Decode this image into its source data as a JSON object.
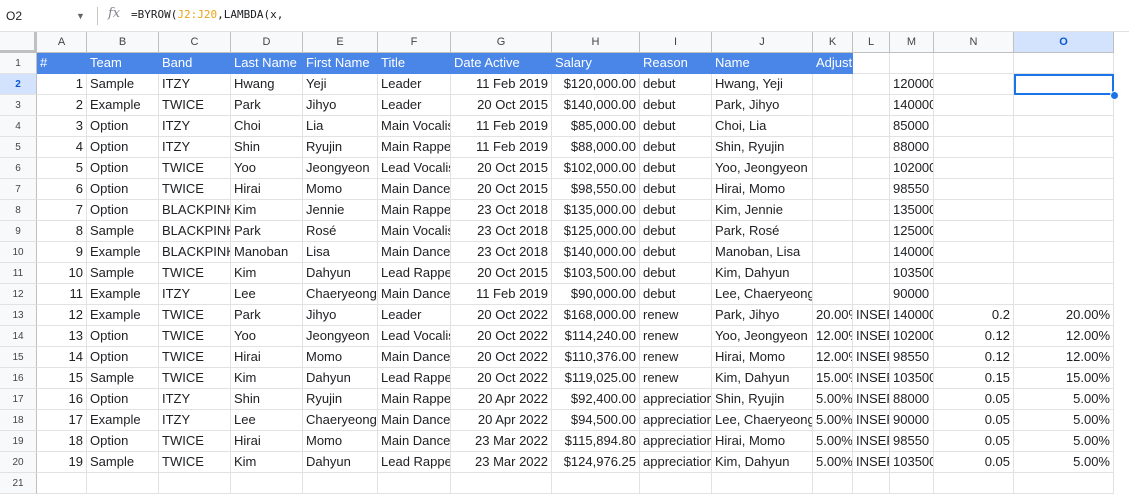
{
  "formula_bar": {
    "name_box": "O2",
    "fx_label": "fx",
    "formula_prefix": "=BYROW(",
    "formula_range": "J2:J20",
    "formula_suffix": ",LAMBDA(x,"
  },
  "columns": [
    "A",
    "B",
    "C",
    "D",
    "E",
    "F",
    "G",
    "H",
    "I",
    "J",
    "K",
    "L",
    "M",
    "N",
    "O"
  ],
  "selected_column": "O",
  "selected_row": "2",
  "rows": [
    "1",
    "2",
    "3",
    "4",
    "5",
    "6",
    "7",
    "8",
    "9",
    "10",
    "11",
    "12",
    "13",
    "14",
    "15",
    "16",
    "17",
    "18",
    "19",
    "20",
    "21"
  ],
  "header_row": [
    "#",
    "Team",
    "Band",
    "Last Name",
    "First Name",
    "Title",
    "Date Active",
    "Salary",
    "Reason",
    "Name",
    "Adjustment"
  ],
  "data_rows": [
    [
      "1",
      "Sample",
      "ITZY",
      "Hwang",
      "Yeji",
      "Leader",
      "11 Feb 2019",
      "$120,000.00",
      "debut",
      "Hwang, Yeji",
      "",
      "",
      "120000",
      "",
      ""
    ],
    [
      "2",
      "Example",
      "TWICE",
      "Park",
      "Jihyo",
      "Leader",
      "20 Oct 2015",
      "$140,000.00",
      "debut",
      "Park, Jihyo",
      "",
      "",
      "140000",
      "",
      ""
    ],
    [
      "3",
      "Option",
      "ITZY",
      "Choi",
      "Lia",
      "Main Vocalist",
      "11 Feb 2019",
      "$85,000.00",
      "debut",
      "Choi, Lia",
      "",
      "",
      "85000",
      "",
      ""
    ],
    [
      "4",
      "Option",
      "ITZY",
      "Shin",
      "Ryujin",
      "Main Rapper",
      "11 Feb 2019",
      "$88,000.00",
      "debut",
      "Shin, Ryujin",
      "",
      "",
      "88000",
      "",
      ""
    ],
    [
      "5",
      "Option",
      "TWICE",
      "Yoo",
      "Jeongyeon",
      "Lead Vocalist",
      "20 Oct 2015",
      "$102,000.00",
      "debut",
      "Yoo, Jeongyeon",
      "",
      "",
      "102000",
      "",
      ""
    ],
    [
      "6",
      "Option",
      "TWICE",
      "Hirai",
      "Momo",
      "Main Dancer",
      "20 Oct 2015",
      "$98,550.00",
      "debut",
      "Hirai, Momo",
      "",
      "",
      "98550",
      "",
      ""
    ],
    [
      "7",
      "Option",
      "BLACKPINK",
      "Kim",
      "Jennie",
      "Main Rapper",
      "23 Oct 2018",
      "$135,000.00",
      "debut",
      "Kim, Jennie",
      "",
      "",
      "135000",
      "",
      ""
    ],
    [
      "8",
      "Sample",
      "BLACKPINK",
      "Park",
      "Rosé",
      "Main Vocalist",
      "23 Oct 2018",
      "$125,000.00",
      "debut",
      "Park, Rosé",
      "",
      "",
      "125000",
      "",
      ""
    ],
    [
      "9",
      "Example",
      "BLACKPINK",
      "Manoban",
      "Lisa",
      "Main Dancer",
      "23 Oct 2018",
      "$140,000.00",
      "debut",
      "Manoban, Lisa",
      "",
      "",
      "140000",
      "",
      ""
    ],
    [
      "10",
      "Sample",
      "TWICE",
      "Kim",
      "Dahyun",
      "Lead Rapper",
      "20 Oct 2015",
      "$103,500.00",
      "debut",
      "Kim, Dahyun",
      "",
      "",
      "103500",
      "",
      ""
    ],
    [
      "11",
      "Example",
      "ITZY",
      "Lee",
      "Chaeryeong",
      "Main Dancer",
      "11 Feb 2019",
      "$90,000.00",
      "debut",
      "Lee, Chaeryeong",
      "",
      "",
      "90000",
      "",
      ""
    ],
    [
      "12",
      "Example",
      "TWICE",
      "Park",
      "Jihyo",
      "Leader",
      "20 Oct 2022",
      "$168,000.00",
      "renew",
      "Park, Jihyo",
      "20.00%",
      "INSERT",
      "140000",
      "0.2",
      "20.00%"
    ],
    [
      "13",
      "Option",
      "TWICE",
      "Yoo",
      "Jeongyeon",
      "Lead Vocalist",
      "20 Oct 2022",
      "$114,240.00",
      "renew",
      "Yoo, Jeongyeon",
      "12.00%",
      "INSERT",
      "102000",
      "0.12",
      "12.00%"
    ],
    [
      "14",
      "Option",
      "TWICE",
      "Hirai",
      "Momo",
      "Main Dancer",
      "20 Oct 2022",
      "$110,376.00",
      "renew",
      "Hirai, Momo",
      "12.00%",
      "INSERT",
      "98550",
      "0.12",
      "12.00%"
    ],
    [
      "15",
      "Sample",
      "TWICE",
      "Kim",
      "Dahyun",
      "Lead Rapper",
      "20 Oct 2022",
      "$119,025.00",
      "renew",
      "Kim, Dahyun",
      "15.00%",
      "INSERT",
      "103500",
      "0.15",
      "15.00%"
    ],
    [
      "16",
      "Option",
      "ITZY",
      "Shin",
      "Ryujin",
      "Main Rapper",
      "20 Apr 2022",
      "$92,400.00",
      "appreciation",
      "Shin, Ryujin",
      "5.00%",
      "INSERT",
      "88000",
      "0.05",
      "5.00%"
    ],
    [
      "17",
      "Example",
      "ITZY",
      "Lee",
      "Chaeryeong",
      "Main Dancer",
      "20 Apr 2022",
      "$94,500.00",
      "appreciation",
      "Lee, Chaeryeong",
      "5.00%",
      "INSERT",
      "90000",
      "0.05",
      "5.00%"
    ],
    [
      "18",
      "Option",
      "TWICE",
      "Hirai",
      "Momo",
      "Main Dancer",
      "23 Mar 2022",
      "$115,894.80",
      "appreciation",
      "Hirai, Momo",
      "5.00%",
      "INSERT",
      "98550",
      "0.05",
      "5.00%"
    ],
    [
      "19",
      "Sample",
      "TWICE",
      "Kim",
      "Dahyun",
      "Lead Rapper",
      "23 Mar 2022",
      "$124,976.25",
      "appreciation",
      "Kim, Dahyun",
      "5.00%",
      "INSERT",
      "103500",
      "0.05",
      "5.00%"
    ]
  ],
  "colors": {
    "header_fill": "#4a86e8",
    "selection": "#1a73e8"
  }
}
